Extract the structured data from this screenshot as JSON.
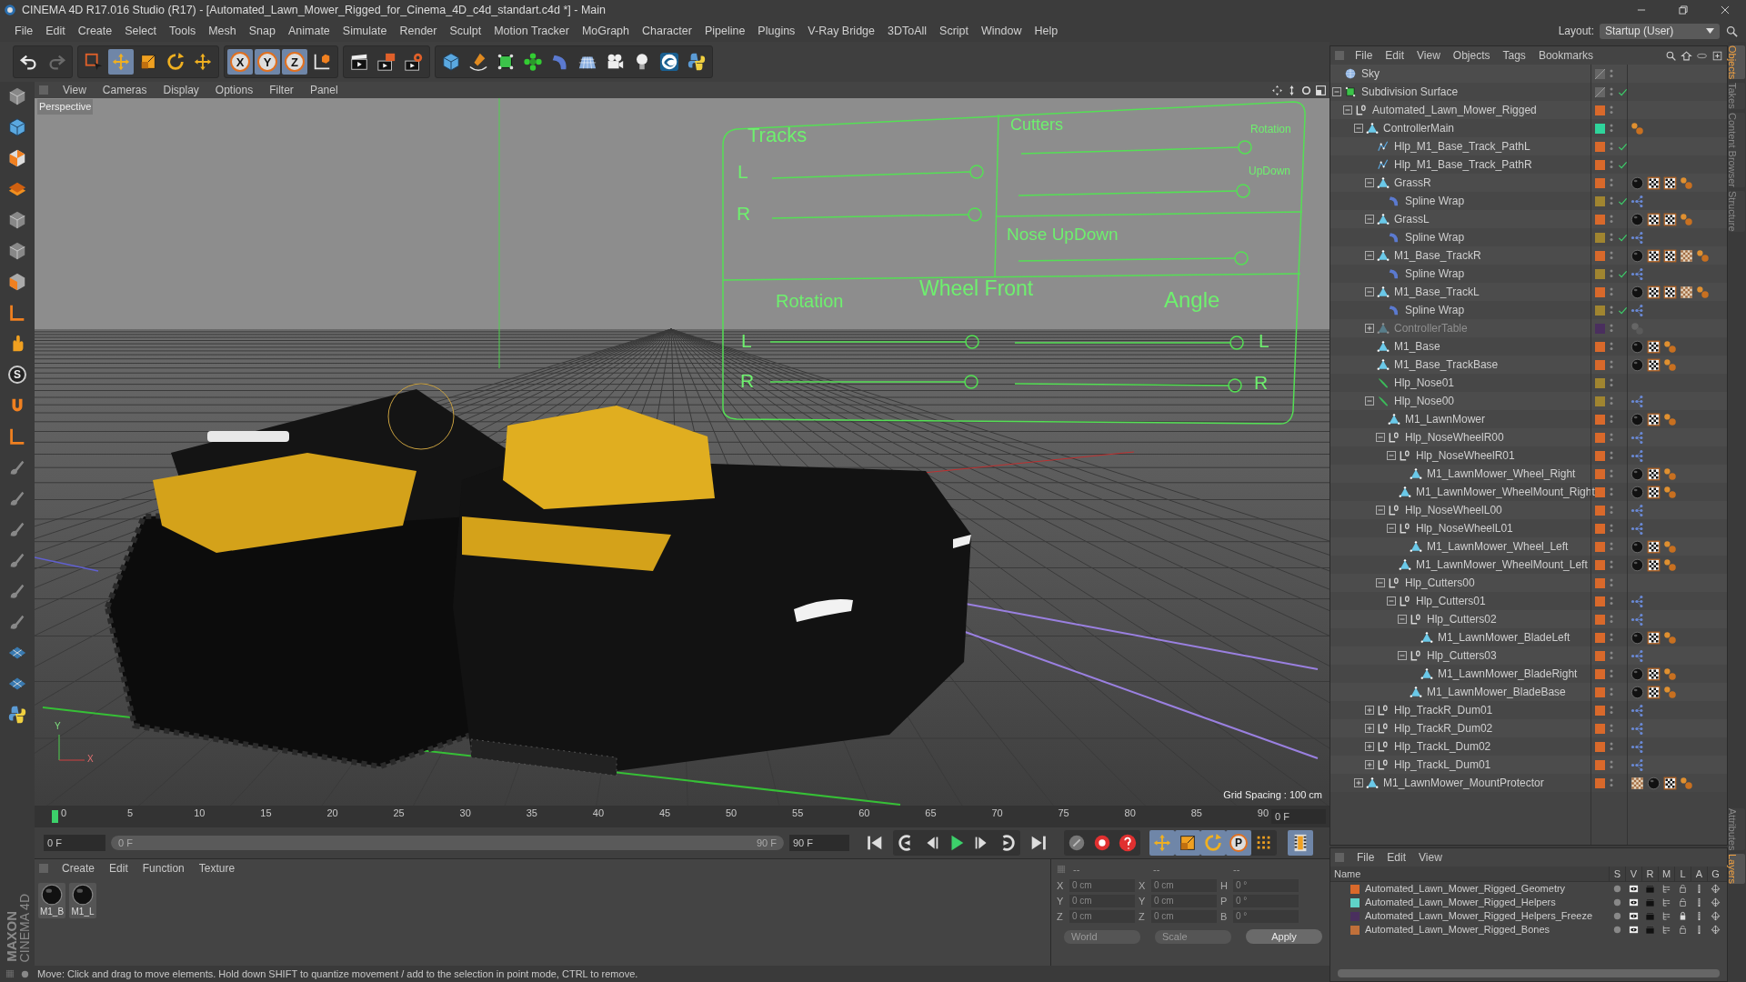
{
  "window": {
    "title": "CINEMA 4D R17.016 Studio (R17) - [Automated_Lawn_Mower_Rigged_for_Cinema_4D_c4d_standart.c4d *] - Main"
  },
  "menu": [
    "File",
    "Edit",
    "Create",
    "Select",
    "Tools",
    "Mesh",
    "Snap",
    "Animate",
    "Simulate",
    "Render",
    "Sculpt",
    "Motion Tracker",
    "MoGraph",
    "Character",
    "Pipeline",
    "Plugins",
    "V-Ray Bridge",
    "3DToAll",
    "Script",
    "Window",
    "Help"
  ],
  "layout": {
    "label": "Layout:",
    "value": "Startup (User)"
  },
  "toolbar": {
    "axis_buttons": [
      "X",
      "Y",
      "Z"
    ]
  },
  "left_toolbar": {
    "letter_button": "S"
  },
  "viewport": {
    "menu": [
      "View",
      "Cameras",
      "Display",
      "Options",
      "Filter",
      "Panel"
    ],
    "camera": "Perspective",
    "grid_spacing": "Grid Spacing : 100 cm",
    "axis_gizmo": [
      "Y",
      "X"
    ],
    "controller": {
      "tracks": {
        "title": "Tracks",
        "rows": [
          "L",
          "R"
        ]
      },
      "cutters": {
        "title": "Cutters",
        "rows": [
          "Rotation",
          "UpDown"
        ]
      },
      "nose": {
        "title": "Nose UpDown"
      },
      "wheel_front": {
        "title": "Wheel Front",
        "rotation": {
          "title": "Rotation",
          "rows": [
            "L",
            "R"
          ]
        },
        "angle": {
          "title": "Angle",
          "rows": [
            "L",
            "R"
          ]
        }
      }
    }
  },
  "timeline": {
    "ticks": [
      "0",
      "5",
      "10",
      "15",
      "20",
      "25",
      "30",
      "35",
      "40",
      "45",
      "50",
      "55",
      "60",
      "65",
      "70",
      "75",
      "80",
      "85",
      "90"
    ],
    "current_frame": "0 F",
    "start_field": "0 F",
    "range": {
      "level": 1,
      "start": "0 F",
      "end": "90 F"
    },
    "end_field": "90 F",
    "key_label": "P"
  },
  "materials": {
    "menu": [
      "Create",
      "Edit",
      "Function",
      "Texture"
    ],
    "items": [
      "M1_B",
      "M1_L"
    ]
  },
  "coordinates": {
    "headers": [
      "--",
      "--",
      "--"
    ],
    "rows": [
      {
        "fields": [
          {
            "axis": "X",
            "value": "0 cm"
          },
          {
            "axis": "X",
            "value": "0 cm"
          },
          {
            "axis": "H",
            "value": "0 °"
          }
        ]
      },
      {
        "fields": [
          {
            "axis": "Y",
            "value": "0 cm"
          },
          {
            "axis": "Y",
            "value": "0 cm"
          },
          {
            "axis": "P",
            "value": "0 °"
          }
        ]
      },
      {
        "fields": [
          {
            "axis": "Z",
            "value": "0 cm"
          },
          {
            "axis": "Z",
            "value": "0 cm"
          },
          {
            "axis": "B",
            "value": "0 °"
          }
        ]
      }
    ],
    "mode": "World",
    "scale": "Scale",
    "apply": "Apply"
  },
  "status_bar": "Move: Click and drag to move elements. Hold down SHIFT to quantize movement / add to the selection in point mode, CTRL to remove.",
  "brand": {
    "line1": "MAXON",
    "line2": "CINEMA 4D"
  },
  "objects": {
    "menu": [
      "File",
      "Edit",
      "View",
      "Objects",
      "Tags",
      "Bookmarks"
    ],
    "tree": [
      {
        "name": "Sky",
        "kind": "sky",
        "checked": false,
        "disabled": false
      },
      {
        "name": "Subdivision Surface",
        "kind": "subdivision",
        "checked": true,
        "disabled": false,
        "expanded": true,
        "children": [
          {
            "name": "Automated_Lawn_Mower_Rigged",
            "kind": "null",
            "color": "#d9692b",
            "checked": false,
            "disabled": false,
            "expanded": true,
            "children": [
              {
                "name": "ControllerMain",
                "kind": "polygon",
                "color": "#2fd49b",
                "checked": false,
                "disabled": false,
                "expanded": true,
                "tags": [
                  {
                    "kind": "weight"
                  }
                ],
                "children": [
                  {
                    "name": "Hlp_M1_Base_Track_PathL",
                    "kind": "spline",
                    "color": "#d9692b",
                    "checked": true,
                    "disabled": false
                  },
                  {
                    "name": "Hlp_M1_Base_Track_PathR",
                    "kind": "spline",
                    "color": "#d9692b",
                    "checked": true,
                    "disabled": false
                  },
                  {
                    "name": "GrassR",
                    "kind": "polygon",
                    "color": "#d9692b",
                    "checked": false,
                    "disabled": false,
                    "expanded": true,
                    "tags": [
                      {
                        "kind": "material"
                      },
                      {
                        "kind": "texture"
                      },
                      {
                        "kind": "texture"
                      },
                      {
                        "kind": "weight"
                      }
                    ],
                    "children": [
                      {
                        "name": "Spline Wrap",
                        "kind": "deformer",
                        "color": "#a08530",
                        "checked": true,
                        "disabled": false,
                        "tags": [
                          {
                            "kind": "node"
                          }
                        ]
                      }
                    ]
                  },
                  {
                    "name": "GrassL",
                    "kind": "polygon",
                    "color": "#d9692b",
                    "checked": false,
                    "disabled": false,
                    "expanded": true,
                    "tags": [
                      {
                        "kind": "material"
                      },
                      {
                        "kind": "texture"
                      },
                      {
                        "kind": "texture"
                      },
                      {
                        "kind": "weight"
                      }
                    ],
                    "children": [
                      {
                        "name": "Spline Wrap",
                        "kind": "deformer",
                        "color": "#a08530",
                        "checked": true,
                        "disabled": false,
                        "tags": [
                          {
                            "kind": "node"
                          }
                        ]
                      }
                    ]
                  },
                  {
                    "name": "M1_Base_TrackR",
                    "kind": "polygon",
                    "color": "#d9692b",
                    "checked": false,
                    "disabled": false,
                    "expanded": true,
                    "tags": [
                      {
                        "kind": "material"
                      },
                      {
                        "kind": "texture"
                      },
                      {
                        "kind": "texture"
                      },
                      {
                        "kind": "pattern"
                      },
                      {
                        "kind": "weight"
                      }
                    ],
                    "children": [
                      {
                        "name": "Spline Wrap",
                        "kind": "deformer",
                        "color": "#a08530",
                        "checked": true,
                        "disabled": false,
                        "tags": [
                          {
                            "kind": "node"
                          }
                        ]
                      }
                    ]
                  },
                  {
                    "name": "M1_Base_TrackL",
                    "kind": "polygon",
                    "color": "#d9692b",
                    "checked": false,
                    "disabled": false,
                    "expanded": true,
                    "tags": [
                      {
                        "kind": "material"
                      },
                      {
                        "kind": "texture"
                      },
                      {
                        "kind": "texture"
                      },
                      {
                        "kind": "pattern"
                      },
                      {
                        "kind": "weight"
                      }
                    ],
                    "children": [
                      {
                        "name": "Spline Wrap",
                        "kind": "deformer",
                        "color": "#a08530",
                        "checked": true,
                        "disabled": false,
                        "tags": [
                          {
                            "kind": "node"
                          }
                        ]
                      }
                    ]
                  },
                  {
                    "name": "ControllerTable",
                    "kind": "polygon",
                    "color": "#4a2f5e",
                    "checked": false,
                    "disabled": true,
                    "expanded": false,
                    "tags": [
                      {
                        "kind": "ghost"
                      }
                    ]
                  },
                  {
                    "name": "M1_Base",
                    "kind": "polygon",
                    "color": "#d9692b",
                    "checked": false,
                    "disabled": false,
                    "tags": [
                      {
                        "kind": "material"
                      },
                      {
                        "kind": "texture"
                      },
                      {
                        "kind": "weight"
                      }
                    ]
                  },
                  {
                    "name": "M1_Base_TrackBase",
                    "kind": "polygon",
                    "color": "#d9692b",
                    "checked": false,
                    "disabled": false,
                    "tags": [
                      {
                        "kind": "material"
                      },
                      {
                        "kind": "texture"
                      },
                      {
                        "kind": "weight"
                      }
                    ]
                  },
                  {
                    "name": "Hlp_Nose01",
                    "kind": "bone",
                    "color": "#a08530",
                    "checked": false,
                    "disabled": false
                  },
                  {
                    "name": "Hlp_Nose00",
                    "kind": "bone",
                    "color": "#a08530",
                    "checked": false,
                    "disabled": false,
                    "expanded": true,
                    "tags": [
                      {
                        "kind": "node"
                      }
                    ],
                    "children": [
                      {
                        "name": "M1_LawnMower",
                        "kind": "polygon",
                        "color": "#d9692b",
                        "checked": false,
                        "disabled": false,
                        "tags": [
                          {
                            "kind": "material"
                          },
                          {
                            "kind": "texture"
                          },
                          {
                            "kind": "weight"
                          }
                        ]
                      },
                      {
                        "name": "Hlp_NoseWheelR00",
                        "kind": "null",
                        "color": "#d9692b",
                        "checked": false,
                        "disabled": false,
                        "expanded": true,
                        "tags": [
                          {
                            "kind": "node"
                          }
                        ],
                        "children": [
                          {
                            "name": "Hlp_NoseWheelR01",
                            "kind": "null",
                            "color": "#d9692b",
                            "checked": false,
                            "disabled": false,
                            "expanded": true,
                            "tags": [
                              {
                                "kind": "node"
                              }
                            ],
                            "children": [
                              {
                                "name": "M1_LawnMower_Wheel_Right",
                                "kind": "polygon",
                                "color": "#d9692b",
                                "checked": false,
                                "disabled": false,
                                "tags": [
                                  {
                                    "kind": "material"
                                  },
                                  {
                                    "kind": "texture"
                                  },
                                  {
                                    "kind": "weight"
                                  }
                                ]
                              }
                            ]
                          },
                          {
                            "name": "M1_LawnMower_WheelMount_Right",
                            "kind": "polygon",
                            "color": "#d9692b",
                            "checked": false,
                            "disabled": false,
                            "tags": [
                              {
                                "kind": "material"
                              },
                              {
                                "kind": "texture"
                              },
                              {
                                "kind": "weight"
                              }
                            ]
                          }
                        ]
                      },
                      {
                        "name": "Hlp_NoseWheelL00",
                        "kind": "null",
                        "color": "#d9692b",
                        "checked": false,
                        "disabled": false,
                        "expanded": true,
                        "tags": [
                          {
                            "kind": "node"
                          }
                        ],
                        "children": [
                          {
                            "name": "Hlp_NoseWheelL01",
                            "kind": "null",
                            "color": "#d9692b",
                            "checked": false,
                            "disabled": false,
                            "expanded": true,
                            "tags": [
                              {
                                "kind": "node"
                              }
                            ],
                            "children": [
                              {
                                "name": "M1_LawnMower_Wheel_Left",
                                "kind": "polygon",
                                "color": "#d9692b",
                                "checked": false,
                                "disabled": false,
                                "tags": [
                                  {
                                    "kind": "material"
                                  },
                                  {
                                    "kind": "texture"
                                  },
                                  {
                                    "kind": "weight"
                                  }
                                ]
                              }
                            ]
                          },
                          {
                            "name": "M1_LawnMower_WheelMount_Left",
                            "kind": "polygon",
                            "color": "#d9692b",
                            "checked": false,
                            "disabled": false,
                            "tags": [
                              {
                                "kind": "material"
                              },
                              {
                                "kind": "texture"
                              },
                              {
                                "kind": "weight"
                              }
                            ]
                          }
                        ]
                      },
                      {
                        "name": "Hlp_Cutters00",
                        "kind": "null",
                        "color": "#d9692b",
                        "checked": false,
                        "disabled": false,
                        "expanded": true,
                        "children": [
                          {
                            "name": "Hlp_Cutters01",
                            "kind": "null",
                            "color": "#d9692b",
                            "checked": false,
                            "disabled": false,
                            "expanded": true,
                            "tags": [
                              {
                                "kind": "node"
                              }
                            ],
                            "children": [
                              {
                                "name": "Hlp_Cutters02",
                                "kind": "null",
                                "color": "#d9692b",
                                "checked": false,
                                "disabled": false,
                                "expanded": true,
                                "tags": [
                                  {
                                    "kind": "node"
                                  }
                                ],
                                "children": [
                                  {
                                    "name": "M1_LawnMower_BladeLeft",
                                    "kind": "polygon",
                                    "color": "#d9692b",
                                    "checked": false,
                                    "disabled": false,
                                    "tags": [
                                      {
                                        "kind": "material"
                                      },
                                      {
                                        "kind": "texture"
                                      },
                                      {
                                        "kind": "weight"
                                      }
                                    ]
                                  }
                                ]
                              },
                              {
                                "name": "Hlp_Cutters03",
                                "kind": "null",
                                "color": "#d9692b",
                                "checked": false,
                                "disabled": false,
                                "expanded": true,
                                "tags": [
                                  {
                                    "kind": "node"
                                  }
                                ],
                                "children": [
                                  {
                                    "name": "M1_LawnMower_BladeRight",
                                    "kind": "polygon",
                                    "color": "#d9692b",
                                    "checked": false,
                                    "disabled": false,
                                    "tags": [
                                      {
                                        "kind": "material"
                                      },
                                      {
                                        "kind": "texture"
                                      },
                                      {
                                        "kind": "weight"
                                      }
                                    ]
                                  }
                                ]
                              },
                              {
                                "name": "M1_LawnMower_BladeBase",
                                "kind": "polygon",
                                "color": "#d9692b",
                                "checked": false,
                                "disabled": false,
                                "tags": [
                                  {
                                    "kind": "material"
                                  },
                                  {
                                    "kind": "texture"
                                  },
                                  {
                                    "kind": "weight"
                                  }
                                ]
                              }
                            ]
                          }
                        ]
                      }
                    ]
                  },
                  {
                    "name": "Hlp_TrackR_Dum01",
                    "kind": "null",
                    "color": "#d9692b",
                    "checked": false,
                    "disabled": false,
                    "expanded": false,
                    "tags": [
                      {
                        "kind": "node"
                      }
                    ]
                  },
                  {
                    "name": "Hlp_TrackR_Dum02",
                    "kind": "null",
                    "color": "#d9692b",
                    "checked": false,
                    "disabled": false,
                    "expanded": false,
                    "tags": [
                      {
                        "kind": "node"
                      }
                    ]
                  },
                  {
                    "name": "Hlp_TrackL_Dum02",
                    "kind": "null",
                    "color": "#d9692b",
                    "checked": false,
                    "disabled": false,
                    "expanded": false,
                    "tags": [
                      {
                        "kind": "node"
                      }
                    ]
                  },
                  {
                    "name": "Hlp_TrackL_Dum01",
                    "kind": "null",
                    "color": "#d9692b",
                    "checked": false,
                    "disabled": false,
                    "expanded": false,
                    "tags": [
                      {
                        "kind": "node"
                      }
                    ]
                  }
                ]
              },
              {
                "name": "M1_LawnMower_MountProtector",
                "kind": "polygon",
                "color": "#d9692b",
                "checked": false,
                "disabled": false,
                "expanded": false,
                "tags": [
                  {
                    "kind": "pattern"
                  },
                  {
                    "kind": "material"
                  },
                  {
                    "kind": "texture"
                  },
                  {
                    "kind": "weight"
                  }
                ]
              }
            ]
          }
        ]
      }
    ]
  },
  "layers": {
    "menu": [
      "File",
      "Edit",
      "View"
    ],
    "columns": [
      "Name",
      "S",
      "V",
      "R",
      "M",
      "L",
      "A",
      "G"
    ],
    "rows": [
      {
        "name": "Automated_Lawn_Mower_Rigged_Geometry",
        "color": "#d9692b",
        "locked": false
      },
      {
        "name": "Automated_Lawn_Mower_Rigged_Helpers",
        "color": "#5fd3c8",
        "locked": false
      },
      {
        "name": "Automated_Lawn_Mower_Rigged_Helpers_Freeze",
        "color": "#4a2f5e",
        "locked": true
      },
      {
        "name": "Automated_Lawn_Mower_Rigged_Bones",
        "color": "#c0703a",
        "locked": false
      }
    ]
  },
  "side_tabs": [
    {
      "label": "Objects",
      "selected": true
    },
    {
      "label": "Takes",
      "selected": false
    },
    {
      "label": "Content Browser",
      "selected": false
    },
    {
      "label": "Structure",
      "selected": false
    }
  ],
  "lower_side_tabs": [
    {
      "label": "Attributes",
      "selected": false
    },
    {
      "label": "Layers",
      "selected": true
    }
  ]
}
